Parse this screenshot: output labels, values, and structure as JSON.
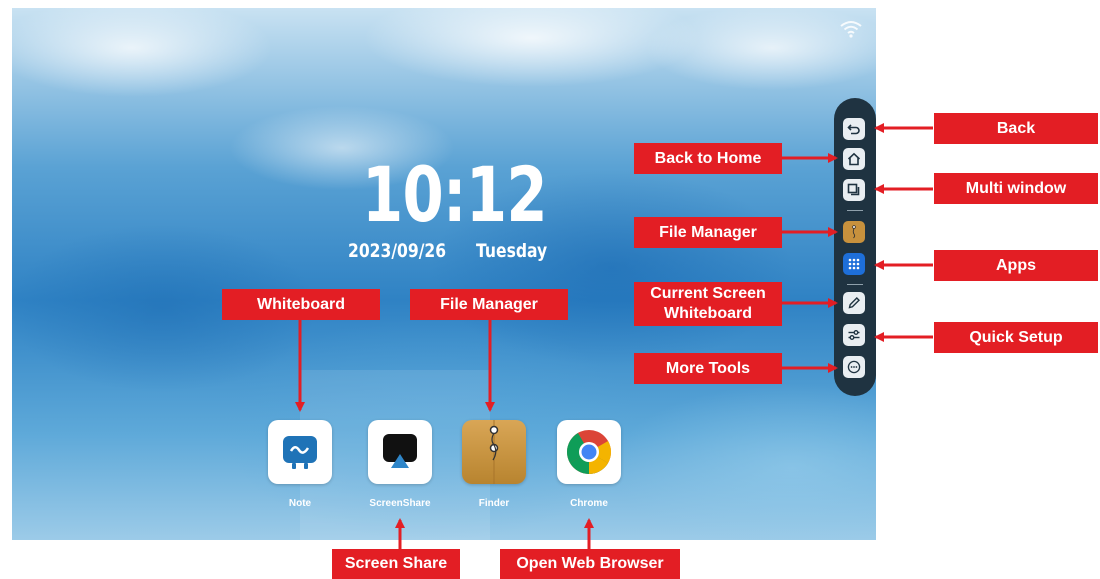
{
  "home": {
    "time": "10:12",
    "date": "2023/09/26",
    "weekday": "Tuesday"
  },
  "apps": [
    {
      "label": "Note",
      "icon": "whiteboard-note-icon"
    },
    {
      "label": "ScreenShare",
      "icon": "screenshare-icon"
    },
    {
      "label": "Finder",
      "icon": "file-folder-icon"
    },
    {
      "label": "Chrome",
      "icon": "chrome-icon"
    }
  ],
  "sidebar": [
    {
      "icon": "back-icon"
    },
    {
      "icon": "home-icon"
    },
    {
      "icon": "multi-window-icon"
    },
    {
      "icon": "file-folder-icon"
    },
    {
      "icon": "apps-grid-icon"
    },
    {
      "icon": "pen-icon"
    },
    {
      "icon": "sliders-icon"
    },
    {
      "icon": "more-icon"
    }
  ],
  "callouts": {
    "back": "Back",
    "back_to_home": "Back to Home",
    "multi_window": "Multi window",
    "file_manager_side": "File Manager",
    "apps": "Apps",
    "current_screen_wb_line1": "Current Screen",
    "current_screen_wb_line2": "Whiteboard",
    "quick_setup": "Quick Setup",
    "more_tools": "More Tools",
    "whiteboard": "Whiteboard",
    "file_manager_dock": "File Manager",
    "screen_share": "Screen Share",
    "open_web_browser": "Open Web Browser"
  },
  "colors": {
    "callout": "#e31e24",
    "sidebar": "#1f3341"
  }
}
